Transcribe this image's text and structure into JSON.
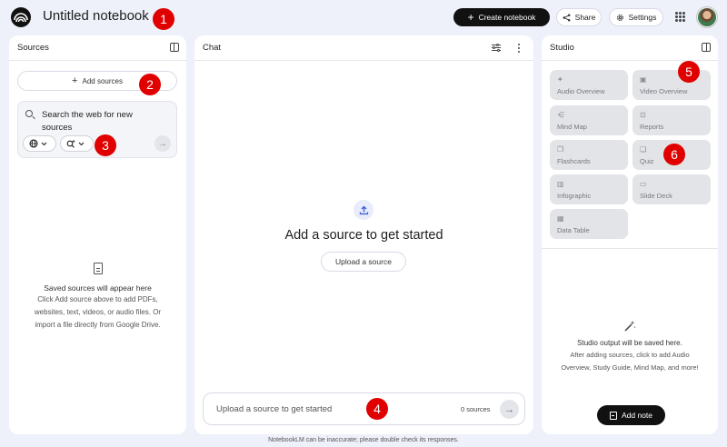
{
  "header": {
    "title": "Untitled notebook",
    "create_label": "Create notebook",
    "share_label": "Share",
    "settings_label": "Settings"
  },
  "markers": [
    "1",
    "2",
    "3",
    "4",
    "5",
    "6"
  ],
  "sources": {
    "title": "Sources",
    "add_label": "Add sources",
    "search_placeholder": "Search the web for new sources",
    "empty_heading": "Saved sources will appear here",
    "empty_lines": [
      "Click Add source above to add PDFs,",
      "websites, text, videos, or audio files. Or",
      "import a file directly from Google Drive."
    ]
  },
  "chat": {
    "title": "Chat",
    "heading": "Add a source to get started",
    "upload_label": "Upload a source",
    "input_placeholder": "Upload a source to get started",
    "source_count": "0 sources"
  },
  "studio": {
    "title": "Studio",
    "tiles": [
      {
        "label": "Audio Overview",
        "icon": "audio-spark-icon"
      },
      {
        "label": "Video Overview",
        "icon": "video-icon"
      },
      {
        "label": "Mind Map",
        "icon": "mind-map-icon"
      },
      {
        "label": "Reports",
        "icon": "reports-icon"
      },
      {
        "label": "Flashcards",
        "icon": "flashcards-icon"
      },
      {
        "label": "Quiz",
        "icon": "quiz-icon"
      },
      {
        "label": "Infographic",
        "icon": "infographic-icon"
      },
      {
        "label": "Slide Deck",
        "icon": "slide-deck-icon"
      },
      {
        "label": "Data Table",
        "icon": "data-table-icon"
      }
    ],
    "empty_heading": "Studio output will be saved here.",
    "empty_lines": [
      "After adding sources, click to add Audio",
      "Overview, Study Guide, Mind Map, and more!"
    ],
    "add_note_label": "Add note"
  },
  "footer": "NotebookLM can be inaccurate; please double check its responses.",
  "colors": {
    "page_bg": "#eef0fa",
    "marker": "#e00000",
    "primary_button": "#111111",
    "tile_bg": "#e3e4e8"
  }
}
